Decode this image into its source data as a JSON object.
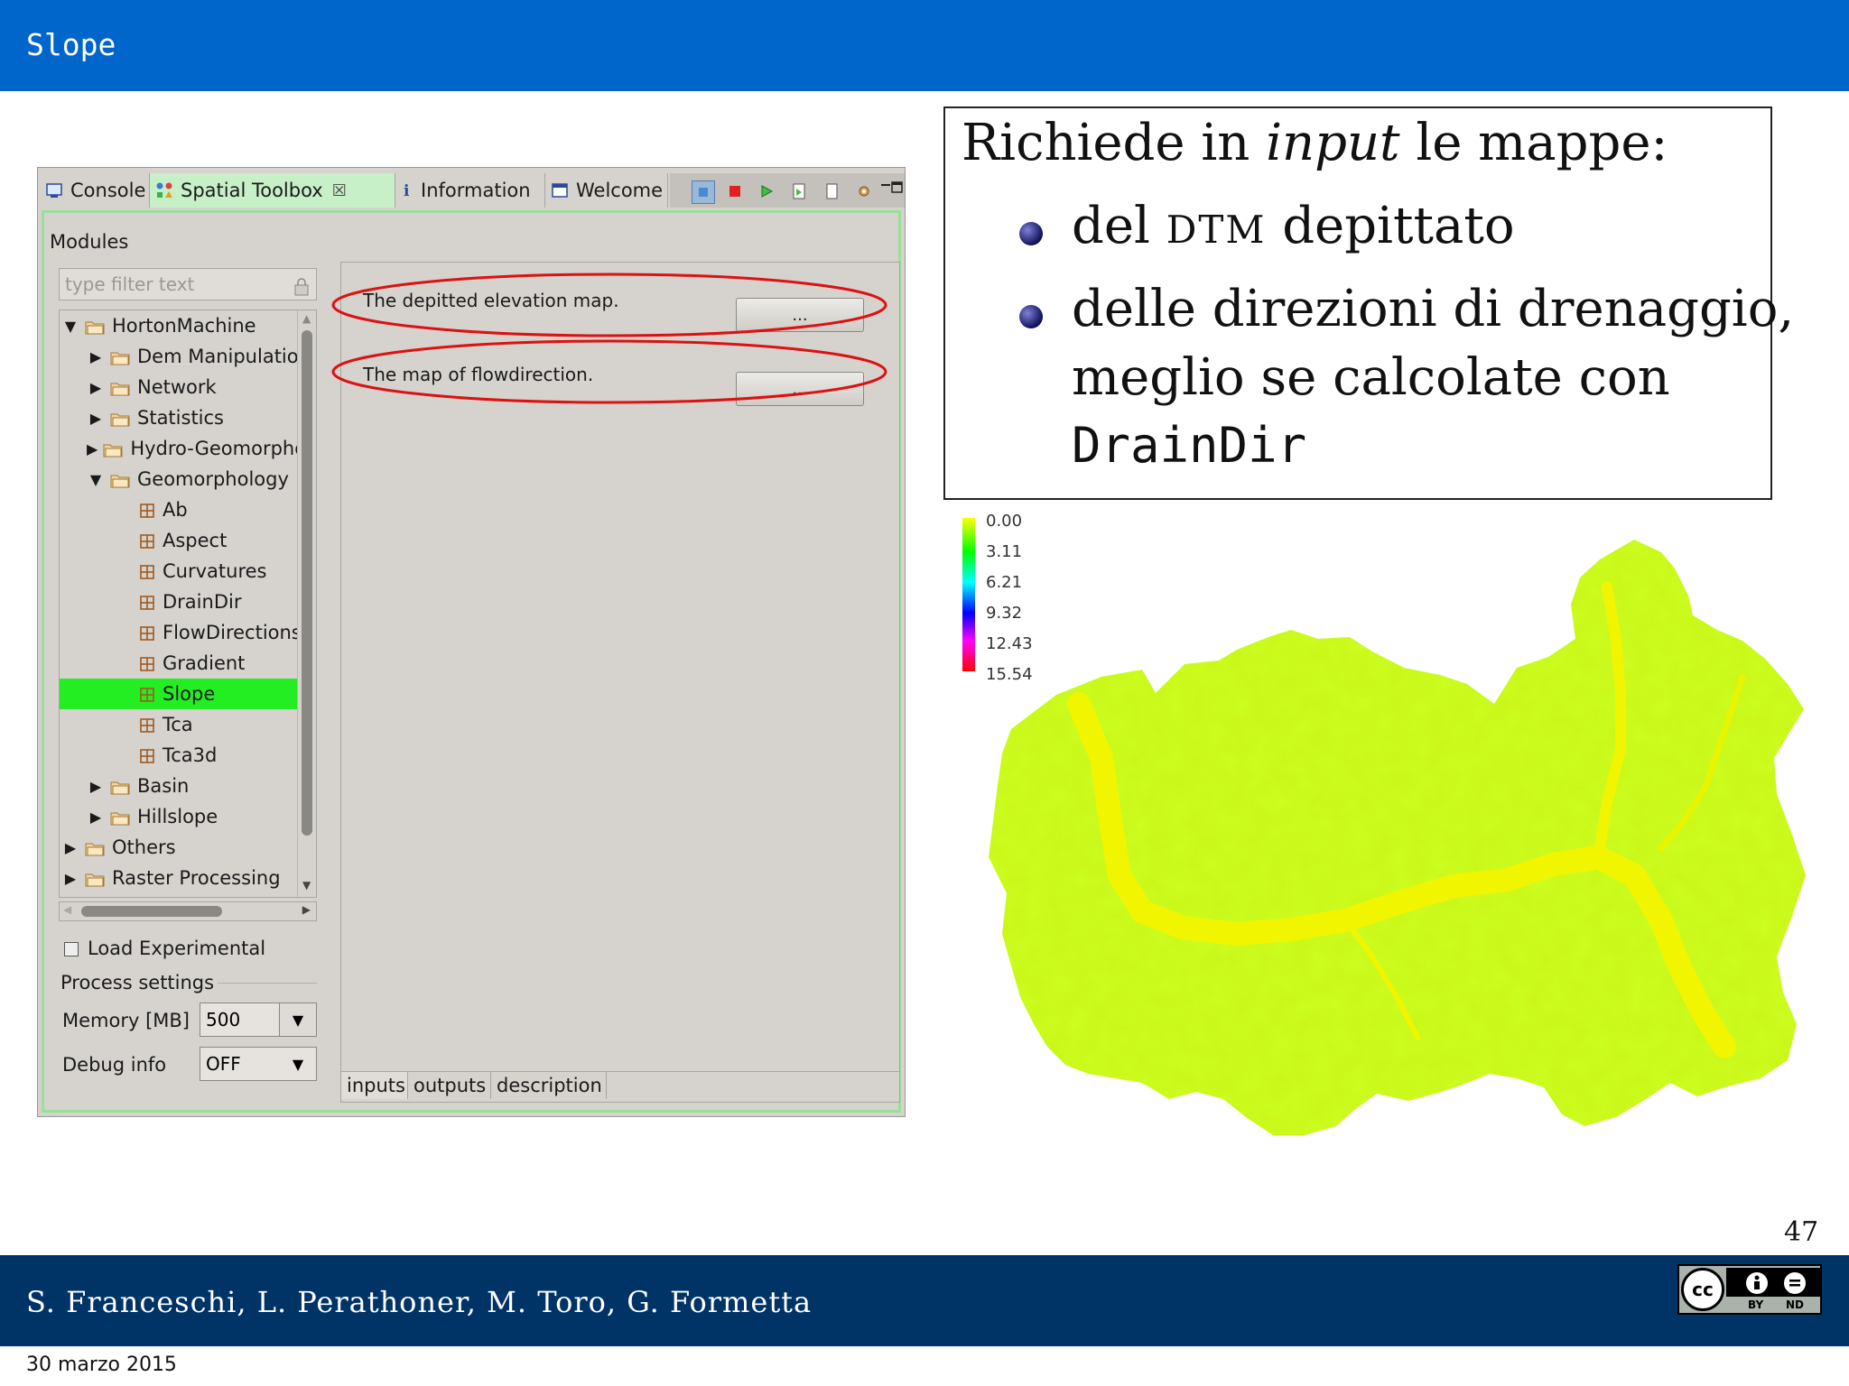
{
  "slide": {
    "title": "Slope",
    "page_number": "47",
    "footer_authors": "S. Franceschi, L. Perathoner, M. Toro, G. Formetta",
    "date": "30 marzo 2015",
    "license_badge": {
      "main": "cc",
      "labels": [
        "BY",
        "ND"
      ]
    }
  },
  "panel": {
    "tabs": [
      {
        "label": "Console",
        "icon": "console-icon"
      },
      {
        "label": "Spatial Toolbox",
        "icon": "toolbox-icon",
        "active": true,
        "close": "☒"
      },
      {
        "label": "Information",
        "icon": "info-icon"
      },
      {
        "label": "Welcome",
        "icon": "welcome-icon"
      }
    ],
    "toolbar_icons": [
      "run-mode-icon",
      "stop-icon",
      "run-icon",
      "generate-script-icon",
      "clear-icon",
      "settings-icon",
      "minimize-icon",
      "maximize-icon"
    ],
    "modules_label": "Modules",
    "filter_placeholder": "type filter text",
    "tree": [
      {
        "label": "HortonMachine",
        "kind": "folder",
        "level": 0,
        "state": "open"
      },
      {
        "label": "Dem Manipulation",
        "kind": "folder",
        "level": 1,
        "state": "closed"
      },
      {
        "label": "Network",
        "kind": "folder",
        "level": 1,
        "state": "closed"
      },
      {
        "label": "Statistics",
        "kind": "folder",
        "level": 1,
        "state": "closed"
      },
      {
        "label": "Hydro-Geomorphology",
        "kind": "folder",
        "level": 1,
        "state": "closed"
      },
      {
        "label": "Geomorphology",
        "kind": "folder",
        "level": 1,
        "state": "open"
      },
      {
        "label": "Ab",
        "kind": "module",
        "level": 2
      },
      {
        "label": "Aspect",
        "kind": "module",
        "level": 2
      },
      {
        "label": "Curvatures",
        "kind": "module",
        "level": 2
      },
      {
        "label": "DrainDir",
        "kind": "module",
        "level": 2
      },
      {
        "label": "FlowDirections",
        "kind": "module",
        "level": 2
      },
      {
        "label": "Gradient",
        "kind": "module",
        "level": 2
      },
      {
        "label": "Slope",
        "kind": "module",
        "level": 2,
        "selected": true
      },
      {
        "label": "Tca",
        "kind": "module",
        "level": 2
      },
      {
        "label": "Tca3d",
        "kind": "module",
        "level": 2
      },
      {
        "label": "Basin",
        "kind": "folder",
        "level": 1,
        "state": "closed"
      },
      {
        "label": "Hillslope",
        "kind": "folder",
        "level": 1,
        "state": "closed"
      },
      {
        "label": "Others",
        "kind": "folder",
        "level": 0,
        "state": "closed"
      },
      {
        "label": "Raster Processing",
        "kind": "folder",
        "level": 0,
        "state": "closed"
      }
    ],
    "load_experimental_label": "Load Experimental",
    "process_settings_label": "Process settings",
    "memory_label": "Memory [MB]",
    "memory_value": "500",
    "debug_label": "Debug info",
    "debug_value": "OFF",
    "inputs": [
      {
        "label": "The depitted elevation map.",
        "button": "..."
      },
      {
        "label": "The map of flowdirection.",
        "button": "..."
      }
    ],
    "bottom_tabs": [
      "inputs",
      "outputs",
      "description"
    ]
  },
  "textbox": {
    "intro_pre": "Richiede in ",
    "intro_em": "input",
    "intro_post": " le mappe:",
    "bullet1_pre": "del ",
    "bullet1_sc": "DTM",
    "bullet1_post": " depittato",
    "bullet2_line1": "delle direzioni di drenaggio,",
    "bullet2_line2": "meglio se calcolate con",
    "bullet2_code": "DrainDir"
  },
  "legend": {
    "values": [
      "0.00",
      "3.11",
      "6.21",
      "9.32",
      "12.43",
      "15.54"
    ],
    "colors": [
      "#ffff00",
      "#00ff00",
      "#00ffff",
      "#0000ff",
      "#ff00ff",
      "#ff0000"
    ]
  },
  "colors": {
    "header": "#0066cc",
    "footer": "#003366",
    "selection": "#22ee22",
    "highlight_ellipse": "#dd1111",
    "map_fill": "#ccff22",
    "valley_fill": "#f2f500"
  }
}
